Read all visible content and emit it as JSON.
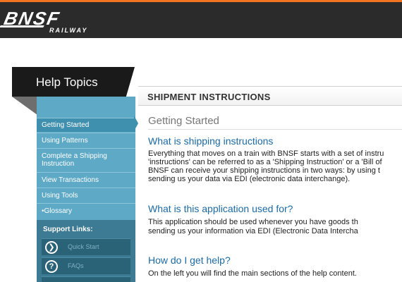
{
  "brand": {
    "name": "BNSF",
    "sub": "RAILWAY",
    "accent": "#f37421"
  },
  "help": {
    "title": "Help Topics"
  },
  "nav": {
    "items": [
      {
        "label": "Getting Started",
        "active": true
      },
      {
        "label": "Using Patterns"
      },
      {
        "label_line1": "Complete a Shipping",
        "label_line2": "Instruction"
      },
      {
        "label": "View Transactions"
      },
      {
        "label": "Using Tools"
      },
      {
        "label": "•Glossary"
      }
    ]
  },
  "support": {
    "title": "Support Links:",
    "links": [
      {
        "label": "Quick Start",
        "icon": "play-circle-icon"
      },
      {
        "label": "FAQs",
        "icon": "question-circle-icon"
      }
    ]
  },
  "content": {
    "header": "SHIPMENT INSTRUCTIONS",
    "section": "Getting Started",
    "q1": "What is shipping instructions",
    "p1": [
      "Everything that moves on a train with BNSF starts with a set of instru",
      "'instructions' can be referred to as a 'Shipping Instruction' or a 'Bill of",
      "BNSF can receive your shipping instructions in two ways: by using t",
      "sending us your data via EDI (electronic data interchange)."
    ],
    "q2": "What is this application used for?",
    "p2": [
      "This application should be used whenever you have goods th",
      "sending us your information via EDI (Electronic Data Intercha"
    ],
    "q3": "How do I get help?",
    "p3": [
      "On the left you will find the main sections of the help content."
    ]
  }
}
